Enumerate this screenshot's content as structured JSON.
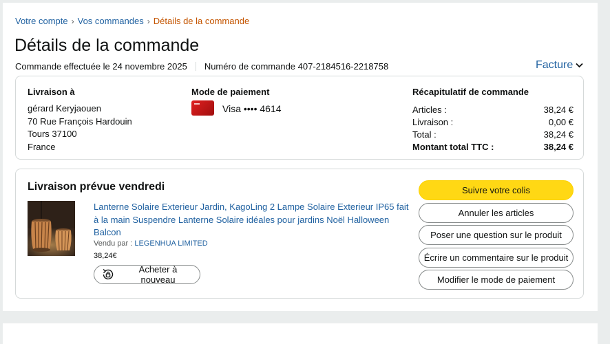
{
  "breadcrumb": {
    "items": [
      "Votre compte",
      "Vos commandes"
    ],
    "separator": "›",
    "current": "Détails de la commande"
  },
  "page_title": "Détails de la commande",
  "order_meta": {
    "date_text": "Commande effectuée le 24 novembre 2025",
    "number_text": "Numéro de commande 407-2184516-2218758"
  },
  "invoice_label": "Facture",
  "shipping": {
    "heading": "Livraison à",
    "lines": [
      "gérard Keryjaouen",
      "70 Rue François Hardouin",
      "Tours 37100",
      "France"
    ]
  },
  "payment": {
    "heading": "Mode de paiement",
    "text": "Visa •••• 4614",
    "card_icon": "visa-card-icon"
  },
  "summary": {
    "heading": "Récapitulatif de commande",
    "rows": [
      {
        "label": "Articles :",
        "value": "38,24 €"
      },
      {
        "label": "Livraison :",
        "value": "0,00 €"
      },
      {
        "label": "Total :",
        "value": "38,24 €"
      }
    ],
    "grand_total": {
      "label": "Montant total TTC :",
      "value": "38,24 €"
    }
  },
  "delivery": {
    "heading": "Livraison prévue vendredi",
    "product": {
      "title": "Lanterne Solaire Exterieur Jardin, KagoLing 2 Lampe Solaire Exterieur IP65 fait à la main Suspendre Lanterne Solaire idéales pour jardins Noël Halloween Balcon",
      "seller_prefix": "Vendu par  :",
      "seller_name": "LEGENHUA LIMITED",
      "price": "38,24€",
      "rebuy_label": "Acheter à nouveau"
    },
    "actions": [
      "Suivre votre colis",
      "Annuler les articles",
      "Poser une question sur le produit",
      "Écrire un commentaire sur le produit",
      "Modifier le mode de paiement"
    ]
  },
  "colors": {
    "link": "#2162a1",
    "current_crumb": "#c45500",
    "primary_button": "#ffd814",
    "border": "#d5d9d9"
  }
}
